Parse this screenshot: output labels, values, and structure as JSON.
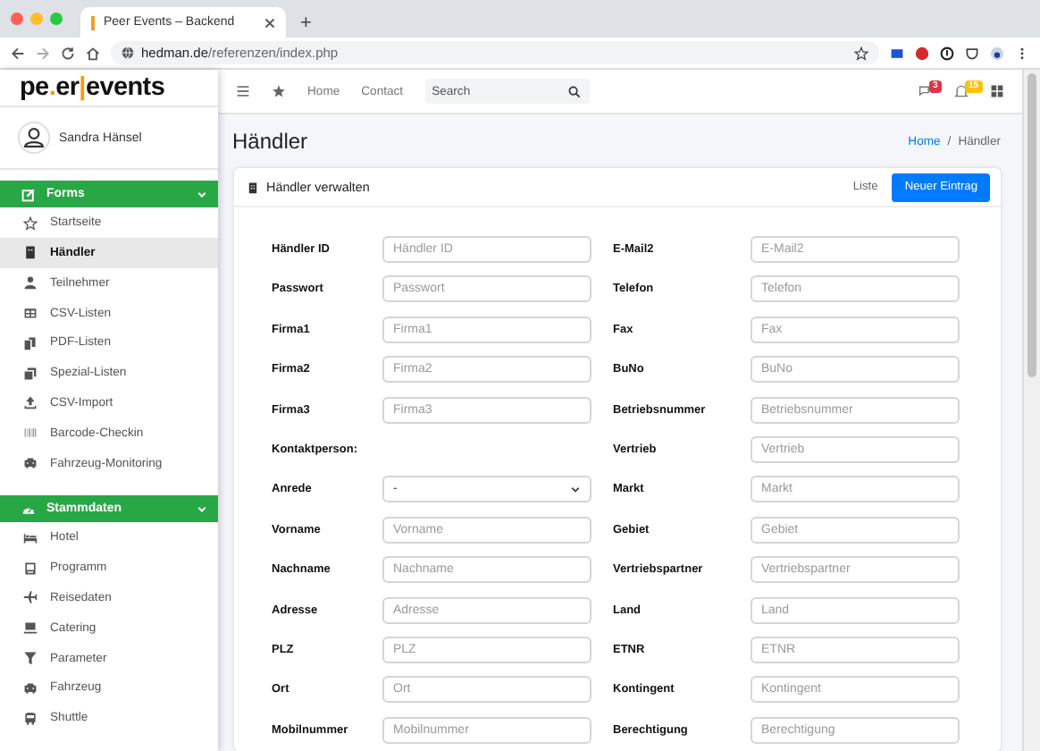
{
  "browser": {
    "tab_title": "Peer Events – Backend",
    "new_tab": "+",
    "url_host": "hedman.de",
    "url_path": "/referenzen/index.php"
  },
  "sidebar": {
    "logo": [
      "pe",
      ".",
      "er",
      "|",
      "events"
    ],
    "user": "Sandra Hänsel",
    "sections": [
      {
        "title": "Forms",
        "expanded": true,
        "items": [
          {
            "label": "Startseite",
            "selected": false
          },
          {
            "label": "Händler",
            "selected": true
          },
          {
            "label": "Teilnehmer",
            "selected": false
          },
          {
            "label": "CSV-Listen",
            "selected": false
          },
          {
            "label": "PDF-Listen",
            "selected": false
          },
          {
            "label": "Spezial-Listen",
            "selected": false
          },
          {
            "label": "CSV-Import",
            "selected": false
          },
          {
            "label": "Barcode-Checkin",
            "selected": false
          },
          {
            "label": "Fahrzeug-Monitoring",
            "selected": false
          }
        ]
      },
      {
        "title": "Stammdaten",
        "expanded": true,
        "items": [
          {
            "label": "Hotel",
            "selected": false
          },
          {
            "label": "Programm",
            "selected": false
          },
          {
            "label": "Reisedaten",
            "selected": false
          },
          {
            "label": "Catering",
            "selected": false
          },
          {
            "label": "Parameter",
            "selected": false
          },
          {
            "label": "Fahrzeug",
            "selected": false
          },
          {
            "label": "Shuttle",
            "selected": false
          }
        ]
      }
    ]
  },
  "navbar": {
    "links": [
      "Home",
      "Contact"
    ],
    "search": {
      "placeholder": "Search"
    },
    "badges": [
      {
        "count": "3",
        "color": "#dc3545"
      },
      {
        "count": "15",
        "color": "#ffc107"
      }
    ]
  },
  "page": {
    "title": "Händler",
    "breadcrumb_separator": "/",
    "breadcrumb": [
      {
        "label": "Home",
        "link": true
      },
      {
        "label": "Händler",
        "link": false
      }
    ]
  },
  "card": {
    "title": "Händler verwalten",
    "list_link": "Liste",
    "new_button": "Neuer Eintrag",
    "left": [
      {
        "label": "Händler ID",
        "kind": "input",
        "placeholder": "Händler ID"
      },
      {
        "label": "Passwort",
        "kind": "input",
        "placeholder": "Passwort"
      },
      {
        "label": "Firma1",
        "kind": "input",
        "placeholder": "Firma1"
      },
      {
        "label": "Firma2",
        "kind": "input",
        "placeholder": "Firma2"
      },
      {
        "label": "Firma3",
        "kind": "input",
        "placeholder": "Firma3"
      },
      {
        "label": "Kontaktperson:",
        "kind": "heading"
      },
      {
        "label": "Anrede",
        "kind": "select",
        "value": "-"
      },
      {
        "label": "Vorname",
        "kind": "input",
        "placeholder": "Vorname"
      },
      {
        "label": "Nachname",
        "kind": "input",
        "placeholder": "Nachname"
      },
      {
        "label": "Adresse",
        "kind": "input",
        "placeholder": "Adresse"
      },
      {
        "label": "PLZ",
        "kind": "input",
        "placeholder": "PLZ"
      },
      {
        "label": "Ort",
        "kind": "input",
        "placeholder": "Ort"
      },
      {
        "label": "Mobilnummer",
        "kind": "input",
        "placeholder": "Mobilnummer"
      }
    ],
    "right": [
      {
        "label": "E-Mail2",
        "kind": "input",
        "placeholder": "E-Mail2"
      },
      {
        "label": "Telefon",
        "kind": "input",
        "placeholder": "Telefon"
      },
      {
        "label": "Fax",
        "kind": "input",
        "placeholder": "Fax"
      },
      {
        "label": "BuNo",
        "kind": "input",
        "placeholder": "BuNo"
      },
      {
        "label": "Betriebsnummer",
        "kind": "input",
        "placeholder": "Betriebsnummer"
      },
      {
        "label": "Vertrieb",
        "kind": "input",
        "placeholder": "Vertrieb"
      },
      {
        "label": "Markt",
        "kind": "input",
        "placeholder": "Markt"
      },
      {
        "label": "Gebiet",
        "kind": "input",
        "placeholder": "Gebiet"
      },
      {
        "label": "Vertriebspartner",
        "kind": "input",
        "placeholder": "Vertriebspartner"
      },
      {
        "label": "Land",
        "kind": "input",
        "placeholder": "Land"
      },
      {
        "label": "ETNR",
        "kind": "input",
        "placeholder": "ETNR"
      },
      {
        "label": "Kontingent",
        "kind": "input",
        "placeholder": "Kontingent"
      },
      {
        "label": "Berechtigung",
        "kind": "input",
        "placeholder": "Berechtigung"
      }
    ]
  }
}
